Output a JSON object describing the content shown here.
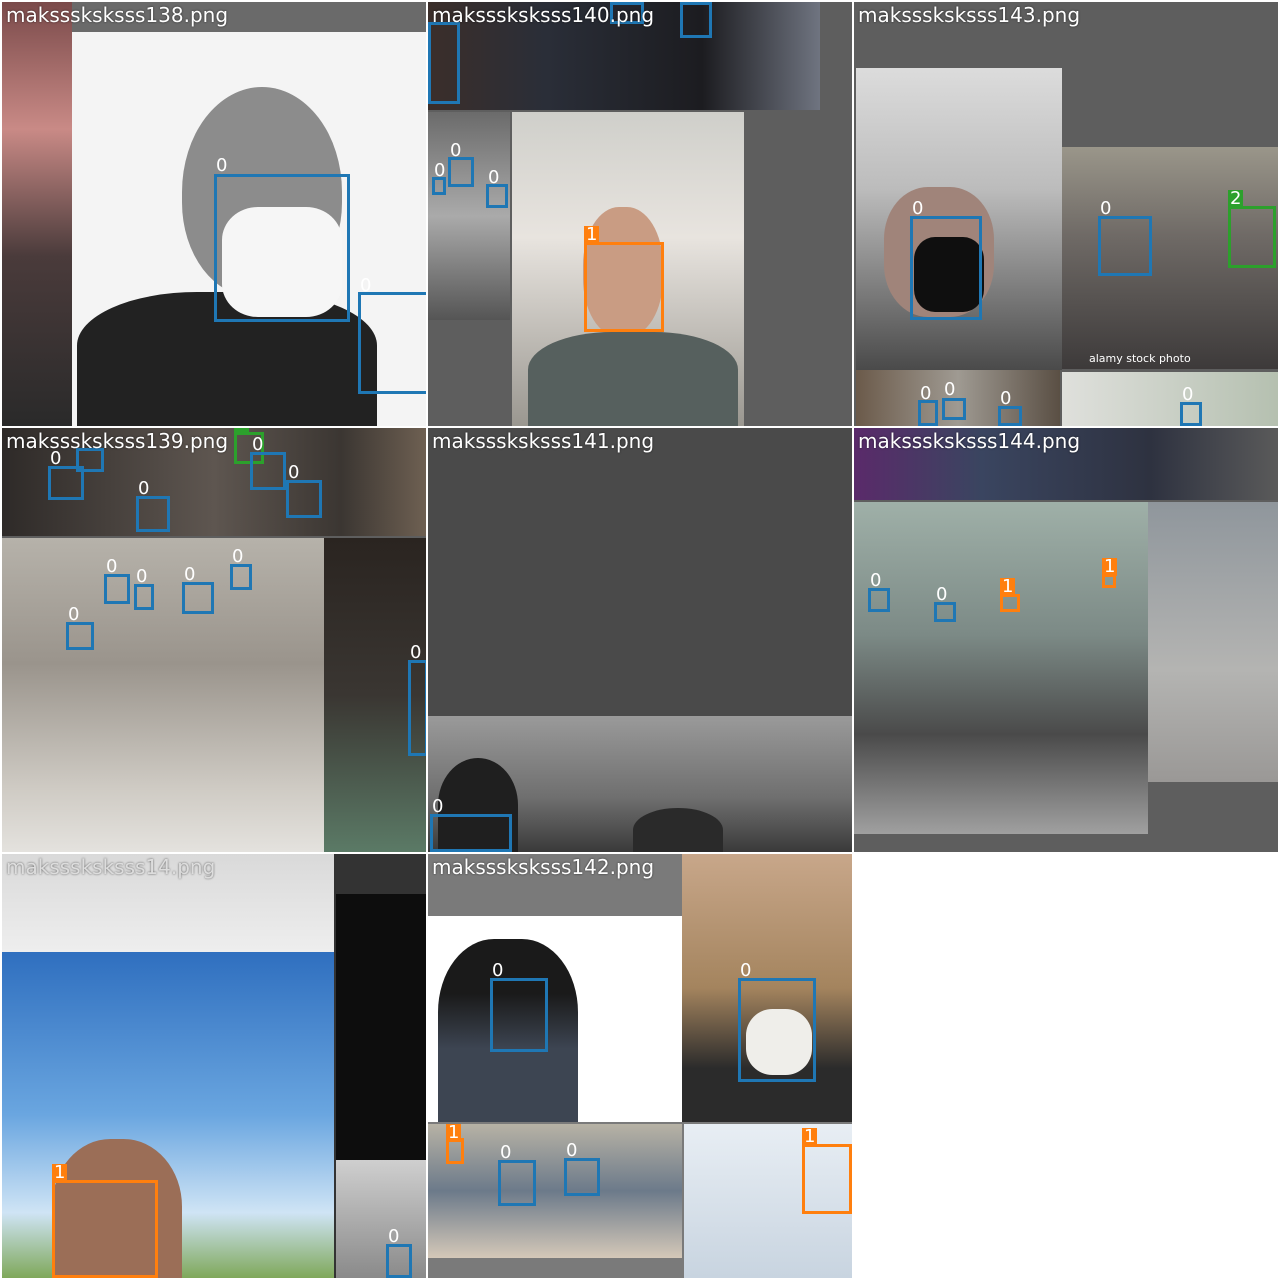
{
  "colors": {
    "class_0": "#1f77b4",
    "class_1": "#ff7f0e",
    "class_2": "#2ca02c",
    "padding": "#5e5e5e"
  },
  "tiles": [
    {
      "title": "maksssksksss138.png"
    },
    {
      "title": "maksssksksss140.png"
    },
    {
      "title": "maksssksksss143.png"
    },
    {
      "title": "maksssksksss139.png"
    },
    {
      "title": "maksssksksss141.png"
    },
    {
      "title": "maksssksksss144.png"
    },
    {
      "title": "maksssksksss14.png"
    },
    {
      "title": "maksssksksss142.png"
    }
  ],
  "labels": {
    "class_0": "0",
    "class_1": "1",
    "class_2": "2"
  },
  "watermark": "alamy stock photo"
}
